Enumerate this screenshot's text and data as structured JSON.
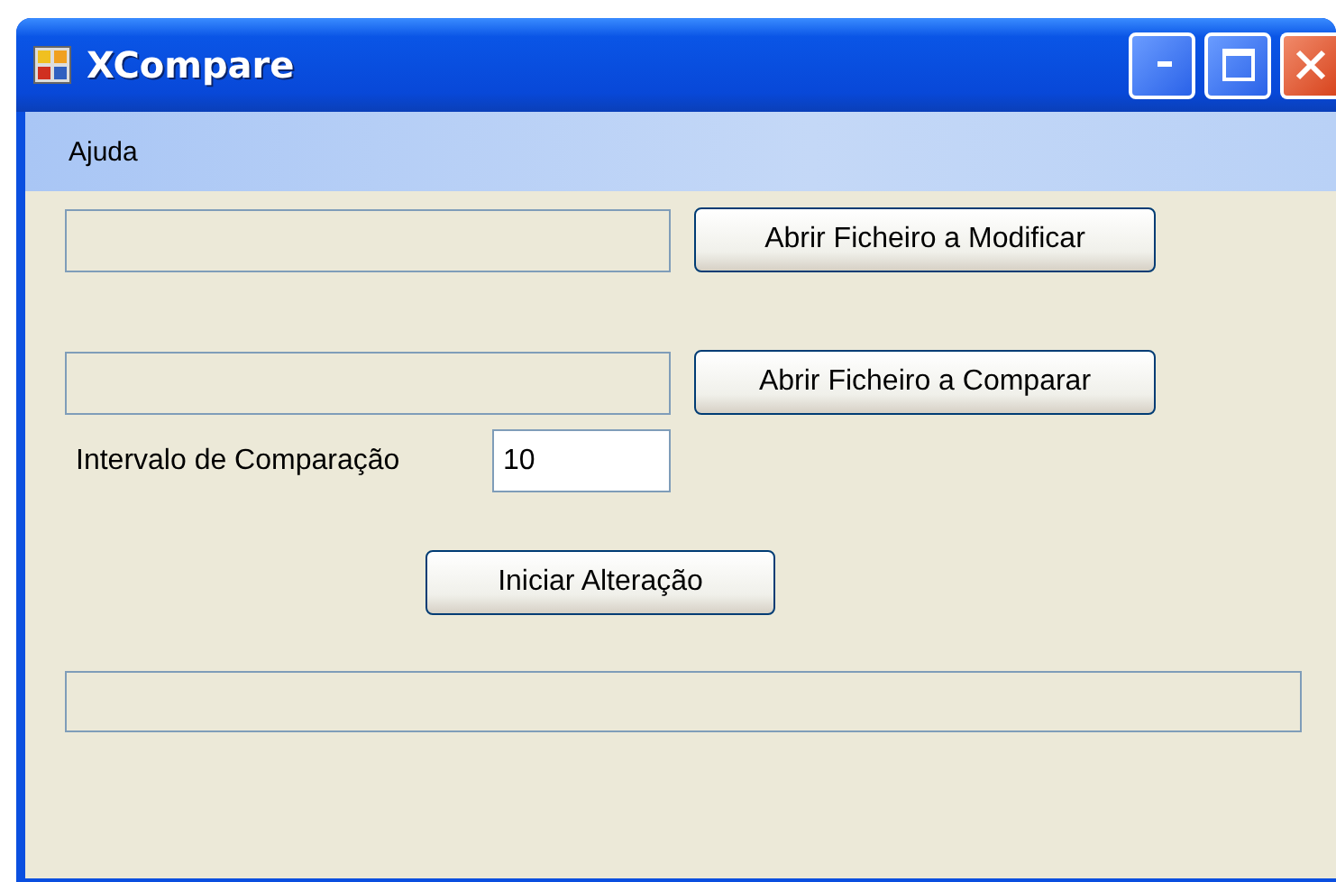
{
  "window": {
    "title": "XCompare"
  },
  "menu": [
    "Ajuda"
  ],
  "file_rows": [
    {
      "path": "",
      "button": "Abrir Ficheiro a Modificar"
    },
    {
      "path": "",
      "button": "Abrir Ficheiro a Comparar"
    }
  ],
  "interval": {
    "label": "Intervalo de Comparação",
    "value": "10"
  },
  "start_button": "Iniciar Alteração"
}
